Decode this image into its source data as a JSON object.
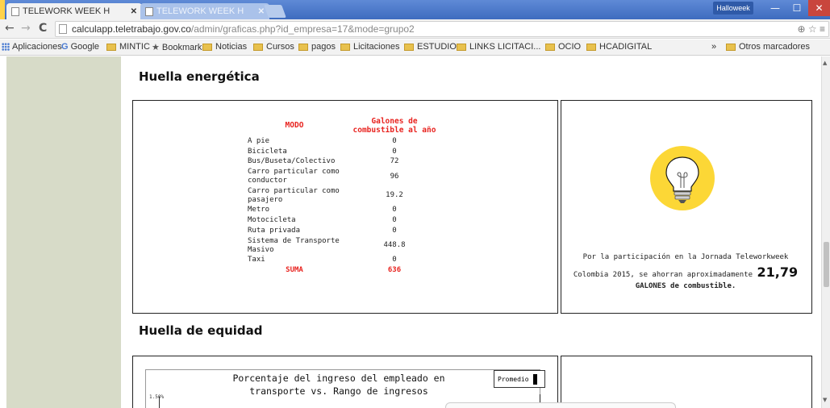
{
  "browser": {
    "tabs": [
      {
        "label": "TELEWORK WEEK H",
        "active": true
      },
      {
        "label": "TELEWORK WEEK H",
        "active": false
      }
    ],
    "profile_name": "Halloweek",
    "url_host": "calculapp.teletrabajo.gov.co",
    "url_path": "/admin/graficas.php?id_empresa=17&mode=grupo2",
    "bookmarks": [
      {
        "label": "Aplicaciones",
        "icon": "apps-grid-icon"
      },
      {
        "label": "Google",
        "icon": "google-icon"
      },
      {
        "label": "MINTIC",
        "icon": "folder-icon"
      },
      {
        "label": "Bookmarks",
        "icon": "star-icon"
      },
      {
        "label": "Noticias",
        "icon": "folder-icon"
      },
      {
        "label": "Cursos",
        "icon": "folder-icon"
      },
      {
        "label": "pagos",
        "icon": "folder-icon"
      },
      {
        "label": "Licitaciones",
        "icon": "folder-icon"
      },
      {
        "label": "ESTUDIO",
        "icon": "folder-icon"
      },
      {
        "label": "LINKS LICITACI...",
        "icon": "folder-icon"
      },
      {
        "label": "OCIO",
        "icon": "folder-icon"
      },
      {
        "label": "HCADIGITAL",
        "icon": "folder-icon"
      },
      {
        "label": "Otros marcadores",
        "icon": "folder-icon"
      }
    ],
    "overflow_label": "»"
  },
  "energy": {
    "title": "Huella energética",
    "col_mode": "MODO",
    "col_gallons": "Galones de combustible al año",
    "rows": [
      {
        "mode": "A pie",
        "value": "0"
      },
      {
        "mode": "Bicicleta",
        "value": "0"
      },
      {
        "mode": "Bus/Buseta/Colectivo",
        "value": "72"
      },
      {
        "mode": "Carro particular como conductor",
        "value": "96"
      },
      {
        "mode": "Carro particular como pasajero",
        "value": "19.2"
      },
      {
        "mode": "Metro",
        "value": "0"
      },
      {
        "mode": "Motocicleta",
        "value": "0"
      },
      {
        "mode": "Ruta privada",
        "value": "0"
      },
      {
        "mode": "Sistema de Transporte Masivo",
        "value": "448.8"
      },
      {
        "mode": "Taxi",
        "value": "0"
      }
    ],
    "sum_label": "SUMA",
    "sum_value": "636",
    "note_prefix": "Por la participación en la Jornada Teleworkweek Colombia 2015, se ahorran aproximadamente",
    "note_amount": "21,79",
    "note_suffix": "GALONES de combustible.",
    "colors": {
      "header_red": "#e8231f",
      "bulb_yellow": "#fcd736"
    }
  },
  "equity": {
    "title": "Huella de equidad",
    "chart_title_line1": "Porcentaje del ingreso del empleado en",
    "chart_title_line2": "transporte vs. Rango de ingresos",
    "legend_label": "Promedio",
    "y_tick_top": "1.50%"
  }
}
